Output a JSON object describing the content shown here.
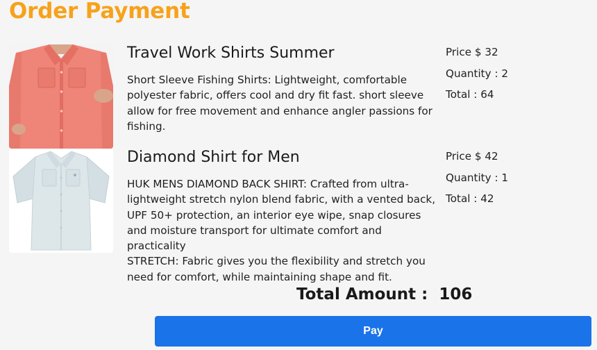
{
  "page": {
    "title": "Order Payment"
  },
  "items": [
    {
      "name": "Travel Work Shirts Summer",
      "description": "Short Sleeve Fishing Shirts: Lightweight, comfortable polyester fabric, offers cool and dry fit fast. short sleeve allow for free movement and enhance angler passions for fishing.",
      "price": "Price $ 32",
      "quantity": "Quantity : 2",
      "total": "Total : 64",
      "image_icon": "pink-short-sleeve-shirt",
      "shirt_color": "#ef8478"
    },
    {
      "name": "Diamond Shirt for Men",
      "description": "HUK MENS DIAMOND BACK SHIRT: Crafted from ultra-lightweight stretch nylon blend fabric, with a vented back, UPF 50+ protection, an interior eye wipe, snap closures and moisture transport for ultimate comfort and practicality\nSTRETCH: Fabric gives you the flexibility and stretch you need for comfort, while maintaining shape and fit.",
      "price": "Price $ 42",
      "quantity": "Quantity : 1",
      "total": "Total : 42",
      "image_icon": "light-blue-short-sleeve-shirt",
      "shirt_color": "#dde7ea"
    }
  ],
  "summary": {
    "total_amount": "Total Amount :  106"
  },
  "actions": {
    "pay_label": "Pay"
  },
  "colors": {
    "title": "#f7a21b",
    "pay_button": "#1a73e8"
  }
}
